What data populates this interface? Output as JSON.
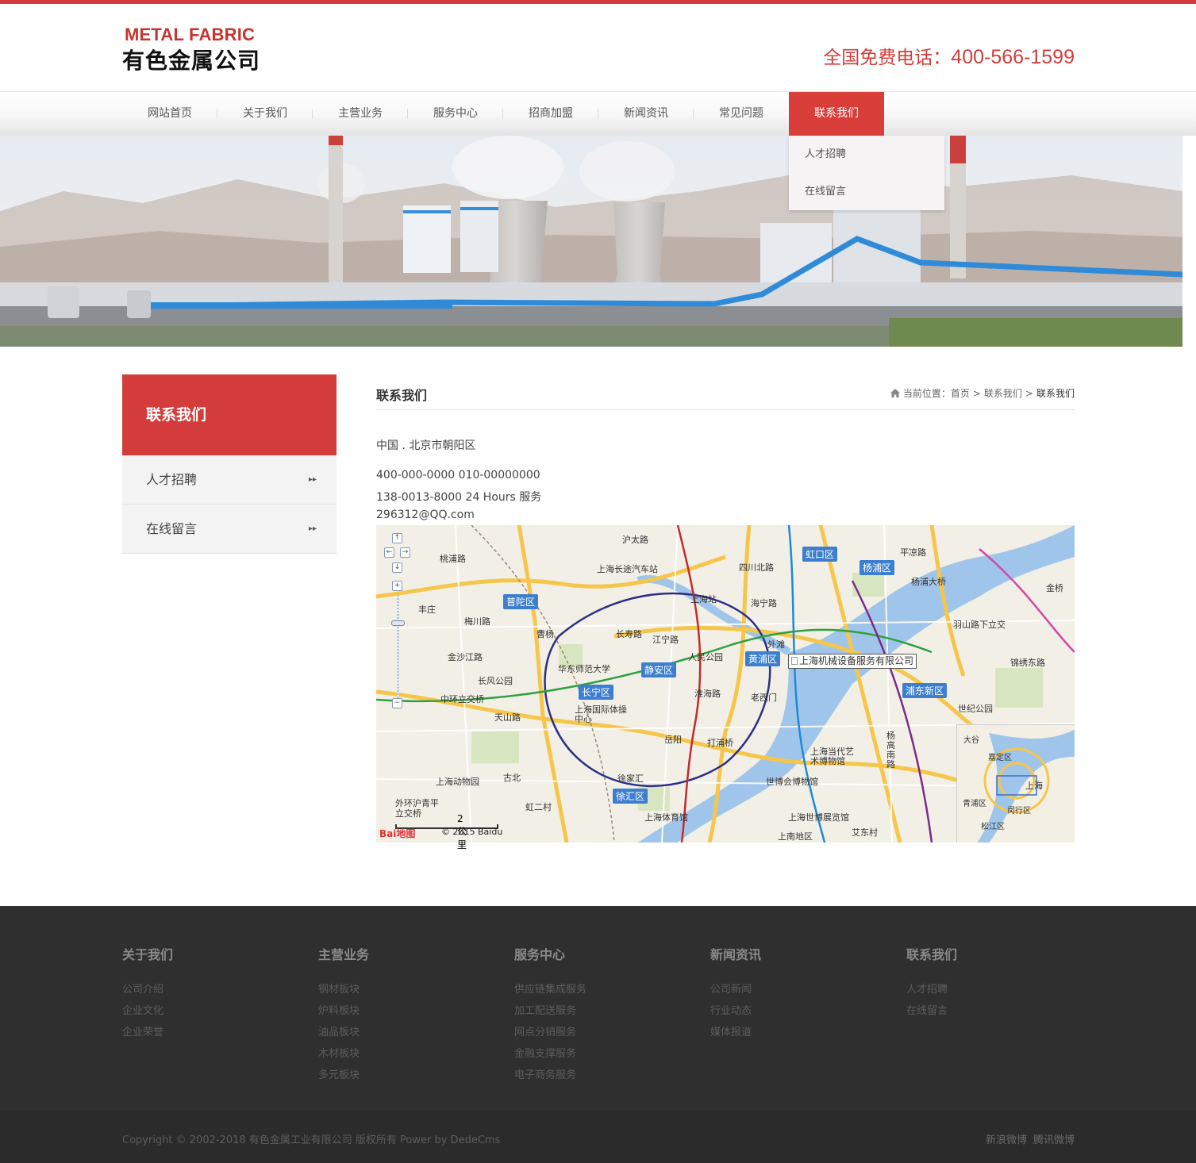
{
  "header": {
    "logo_en": "METAL FABRIC",
    "logo_cn": "有色金属公司",
    "hotline_label": "全国免费电话：",
    "hotline_number": "400-566-1599",
    "accent_color": "#d33c3a"
  },
  "nav": {
    "items": [
      {
        "label": "网站首页"
      },
      {
        "label": "关于我们"
      },
      {
        "label": "主营业务"
      },
      {
        "label": "服务中心"
      },
      {
        "label": "招商加盟"
      },
      {
        "label": "新闻资讯"
      },
      {
        "label": "常见问题"
      },
      {
        "label": "联系我们",
        "active": true
      }
    ],
    "dropdown": [
      "人才招聘",
      "在线留言"
    ]
  },
  "sidebar": {
    "title": "联系我们",
    "items": [
      "人才招聘",
      "在线留言"
    ]
  },
  "main": {
    "title": "联系我们",
    "breadcrumb": {
      "prefix": "当前位置：",
      "home": "首页",
      "sep1": ">",
      "parent": "联系我们",
      "sep2": ">",
      "current": "联系我们"
    },
    "address": "中国 . 北京市朝阳区",
    "phone1": "400-000-0000 010-00000000",
    "phone2": "138-0013-8000 24 Hours 服务",
    "email": "296312@QQ.com"
  },
  "map": {
    "marker_label": "上海机械设备服务有限公司",
    "scale": "2 公里",
    "logo": "Bai地图",
    "copyright": "© 2015 Baidu",
    "districts": [
      "虹口区",
      "杨浦区",
      "普陀区",
      "静安区",
      "黄浦区",
      "长宁区",
      "浦东新区",
      "徐汇区"
    ],
    "labels": [
      "沪太路",
      "桃浦路",
      "上海长途汽车站",
      "四川北路",
      "平凉路",
      "杨浦大桥",
      "丰庄",
      "梅川路",
      "上海站",
      "海宁路",
      "曹杨",
      "长寿路",
      "江宁路",
      "外滩",
      "金沙江路",
      "华东师范大学",
      "人民公园",
      "长风公园",
      "淮海路",
      "老西门",
      "天山路",
      "上海国际体操中心",
      "岳阳",
      "打浦桥",
      "上海动物园",
      "古北",
      "徐家汇",
      "世博会博物馆",
      "上海当代艺术博物馆",
      "上海体育馆",
      "上海世博展览馆",
      "上南地区",
      "艾东村",
      "羽山路下立交",
      "锦绣东路",
      "世纪公园",
      "中环立交桥",
      "杨高南路",
      "虹二村",
      "外环沪青平立交桥",
      "金桥"
    ],
    "minimap_labels": [
      "大谷",
      "嘉定区",
      "上海",
      "青浦区",
      "闵行区",
      "松江区"
    ]
  },
  "footer": {
    "columns": [
      {
        "title": "关于我们",
        "links": [
          "公司介绍",
          "企业文化",
          "企业荣誉"
        ]
      },
      {
        "title": "主营业务",
        "links": [
          "钢材板块",
          "炉料板块",
          "油品板块",
          "木材板块",
          "多元板块"
        ]
      },
      {
        "title": "服务中心",
        "links": [
          "供应链集成服务",
          "加工配送服务",
          "网点分销服务",
          "金融支撑服务",
          "电子商务服务"
        ]
      },
      {
        "title": "新闻资讯",
        "links": [
          "公司新闻",
          "行业动态",
          "媒体报道"
        ]
      },
      {
        "title": "联系我们",
        "links": [
          "人才招聘",
          "在线留言"
        ]
      }
    ],
    "copyright": "Copyright © 2002-2018 有色金属工业有限公司 版权所有 Power by DedeCms",
    "social": [
      "新浪微博",
      "腾讯微博"
    ]
  }
}
